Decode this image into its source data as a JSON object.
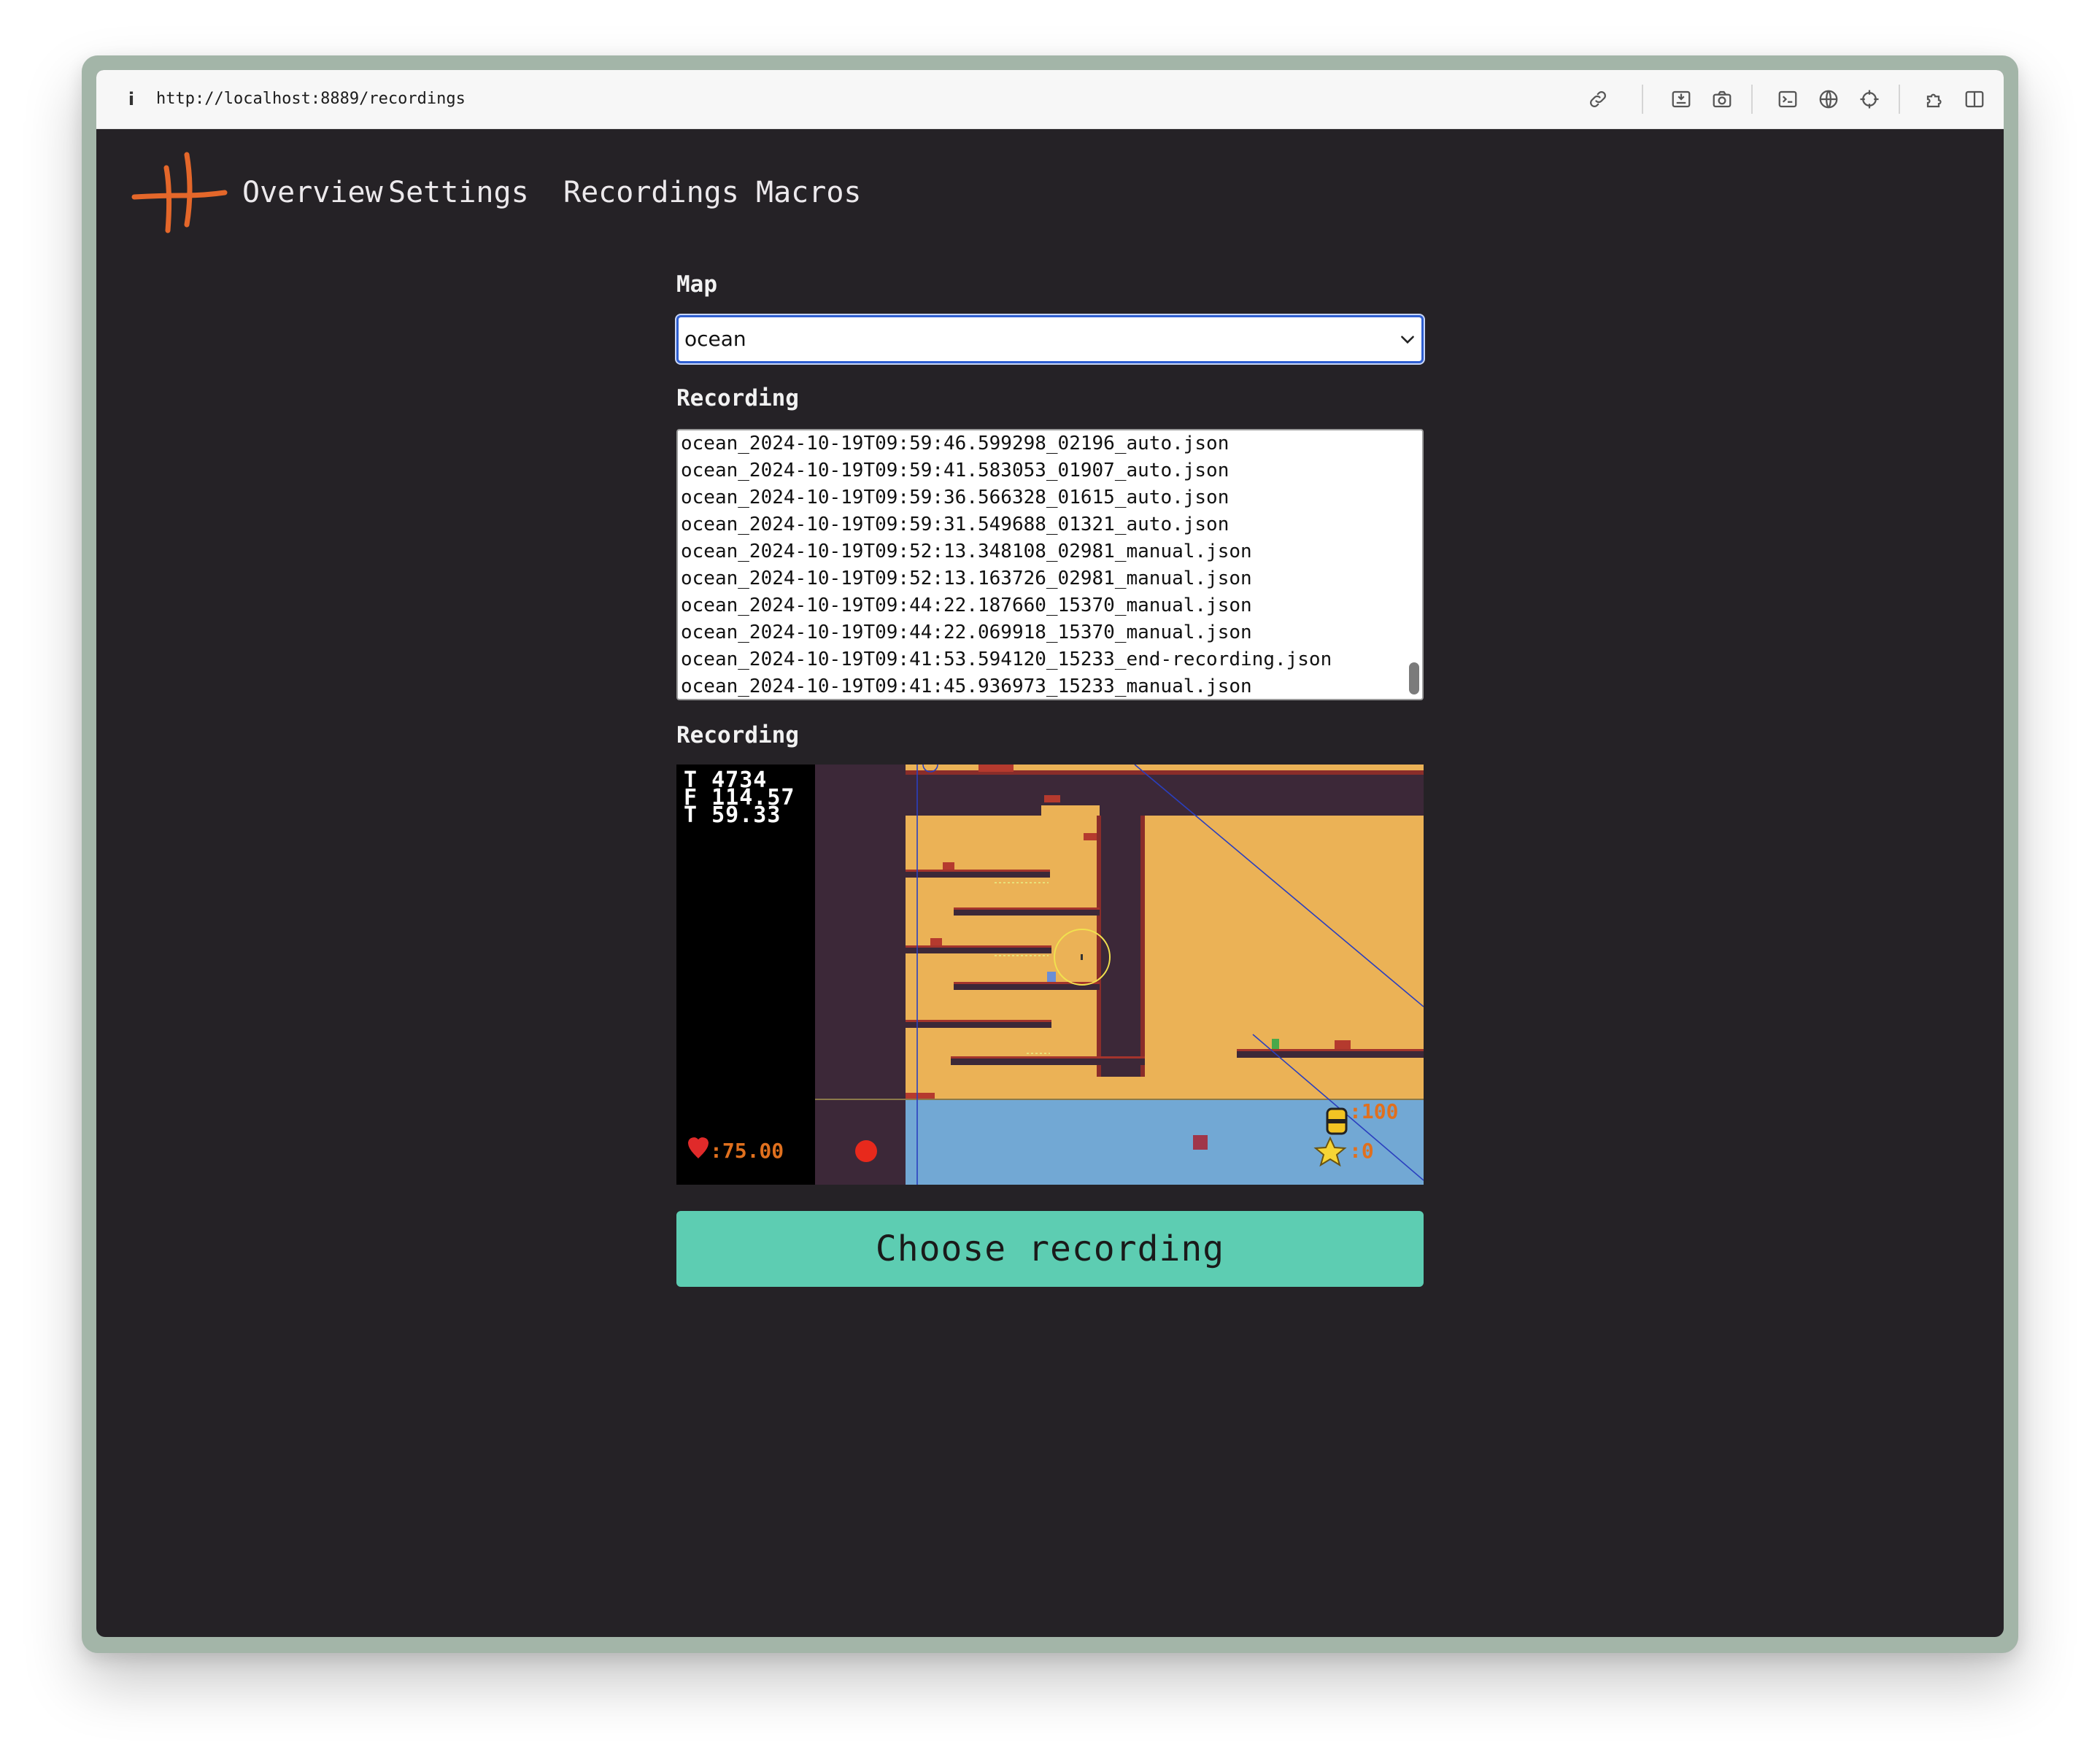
{
  "browser": {
    "url": "http://localhost:8889/recordings",
    "info_icon": "i",
    "toolbar_icons": [
      "link-icon",
      "save-page-icon",
      "camera-icon",
      "terminal-icon",
      "globe-icon",
      "crosshair-icon",
      "extensions-icon",
      "sidebar-icon"
    ]
  },
  "nav": {
    "logo": "logo-mark",
    "links": [
      "Overview",
      "Settings",
      "Recordings",
      "Macros"
    ]
  },
  "form": {
    "map_label": "Map",
    "map_value": "ocean",
    "recording_list_label": "Recording",
    "recordings": [
      "ocean_2024-10-19T09:59:46.599298_02196_auto.json",
      "ocean_2024-10-19T09:59:41.583053_01907_auto.json",
      "ocean_2024-10-19T09:59:36.566328_01615_auto.json",
      "ocean_2024-10-19T09:59:31.549688_01321_auto.json",
      "ocean_2024-10-19T09:52:13.348108_02981_manual.json",
      "ocean_2024-10-19T09:52:13.163726_02981_manual.json",
      "ocean_2024-10-19T09:44:22.187660_15370_manual.json",
      "ocean_2024-10-19T09:44:22.069918_15370_manual.json",
      "ocean_2024-10-19T09:41:53.594120_15233_end-recording.json",
      "ocean_2024-10-19T09:41:45.936973_15233_manual.json"
    ],
    "preview_label": "Recording",
    "choose_button": "Choose recording"
  },
  "preview": {
    "debug_lines": [
      "T 4734",
      "F 114.57",
      "T 59.33"
    ],
    "health": ":75.00",
    "ammo": ":100",
    "stars": ":0",
    "icons": [
      "heart-icon",
      "record-dot-icon",
      "barrel-icon",
      "star-icon"
    ]
  },
  "colors": {
    "accent": "#5dcdb2",
    "logo": "#e4672a",
    "background": "#252226",
    "sand": "#ebb256",
    "wall": "#3c2838",
    "water": "#72a8d4"
  }
}
